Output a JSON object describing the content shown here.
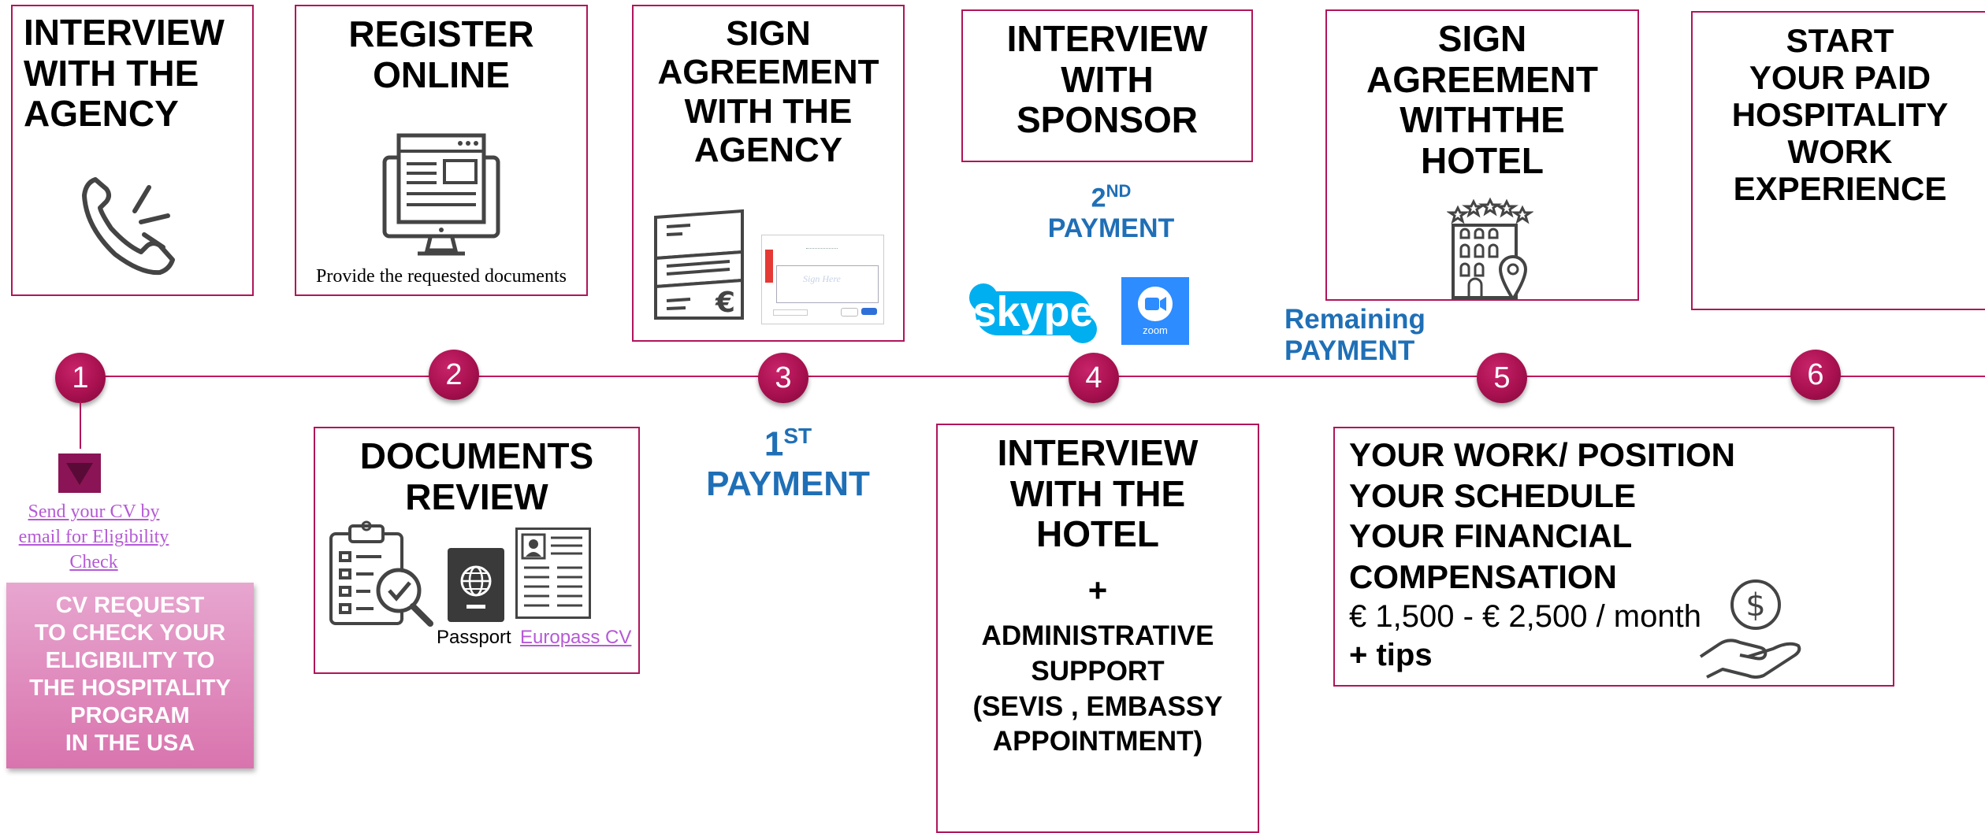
{
  "colors": {
    "accent": "#b0155a",
    "payment_blue": "#1f6fb6",
    "link": "#b55ad6",
    "cv_box": "#d974ae"
  },
  "steps": [
    {
      "number": "1",
      "title": "INTERVIEW\nWITH THE\nAGENCY"
    },
    {
      "number": "2",
      "title": "REGISTER\nONLINE",
      "caption": "Provide the requested documents"
    },
    {
      "number": "3",
      "title": "SIGN\nAGREEMENT\nWITH THE\nAGENCY"
    },
    {
      "number": "4",
      "title": "INTERVIEW\nWITH\nSPONSOR"
    },
    {
      "number": "5",
      "title": "SIGN\nAGREEMENT\nWITHTHE\nHOTEL"
    },
    {
      "number": "6",
      "title": "START\nYOUR PAID\nHOSPITALITY\nWORK\nEXPERIENCE"
    }
  ],
  "cv_link": "Send your CV by email for Eligibility Check",
  "cv_box": "CV REQUEST\nTO CHECK YOUR\nELIGIBILITY TO\nTHE HOSPITALITY\nPROGRAM\nIN THE USA",
  "documents_review": {
    "title": "DOCUMENTS\nREVIEW",
    "passport_label": "Passport",
    "europass_link": "Europass CV"
  },
  "payment_1": {
    "ordinal": "1",
    "sup": "ST",
    "label": "PAYMENT"
  },
  "payment_2": {
    "ordinal": "2",
    "sup": "ND",
    "label": "PAYMENT"
  },
  "payment_remaining": {
    "line1": "Remaining",
    "line2": "PAYMENT"
  },
  "hotel_interview": {
    "title": "INTERVIEW\nWITH THE\nHOTEL",
    "plus": "+",
    "support": "ADMINISTRATIVE\nSUPPORT\n(SEVIS , EMBASSY\nAPPOINTMENT)"
  },
  "work_info": {
    "line1": "YOUR WORK/ POSITION",
    "line2": "YOUR SCHEDULE",
    "line3": "YOUR FINANCIAL",
    "line4": "COMPENSATION",
    "salary": "€ 1,500 - € 2,500 / month",
    "tips": "+ tips"
  },
  "agreement_doc": {
    "sign_here": "Sign Here"
  },
  "apps": {
    "skype": "skype",
    "zoom": "zoom"
  },
  "icons": [
    "phone-ringing-icon",
    "computer-monitor-icon",
    "folded-invoice-icon",
    "esign-document-icon",
    "skype-logo-icon",
    "zoom-logo-icon",
    "hotel-building-icon",
    "clipboard-check-icon",
    "passport-icon",
    "cv-document-icon",
    "money-hand-icon",
    "down-arrow-icon"
  ]
}
